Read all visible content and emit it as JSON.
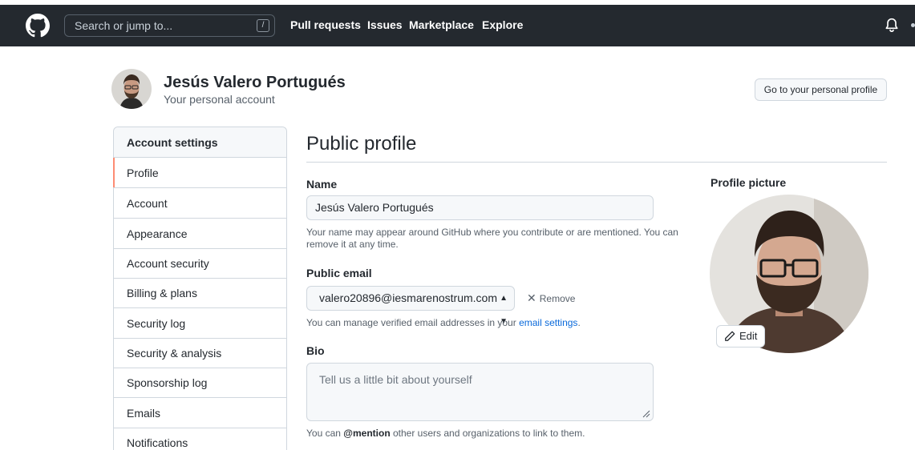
{
  "header": {
    "search_placeholder": "Search or jump to...",
    "search_shortcut": "/",
    "nav": [
      "Pull requests",
      "Issues",
      "Marketplace",
      "Explore"
    ]
  },
  "account": {
    "name": "Jesús Valero Portugués",
    "subtitle": "Your personal account",
    "profile_button": "Go to your personal profile"
  },
  "sidebar": {
    "items": [
      {
        "label": "Account settings"
      },
      {
        "label": "Profile"
      },
      {
        "label": "Account"
      },
      {
        "label": "Appearance"
      },
      {
        "label": "Account security"
      },
      {
        "label": "Billing & plans"
      },
      {
        "label": "Security log"
      },
      {
        "label": "Security & analysis"
      },
      {
        "label": "Sponsorship log"
      },
      {
        "label": "Emails"
      },
      {
        "label": "Notifications"
      }
    ]
  },
  "main": {
    "title": "Public profile",
    "name_label": "Name",
    "name_value": "Jesús Valero Portugués",
    "name_note_line1": "Your name may appear around GitHub where you contribute or are mentioned. You can",
    "name_note_line2": "remove it at any time.",
    "email_label": "Public email",
    "email_value": "valero20896@iesmarenostrum.com",
    "remove_label": "Remove",
    "email_note": "You can manage verified email addresses in your",
    "email_link": "email settings",
    "email_note_end": ".",
    "bio_label": "Bio",
    "bio_placeholder": "Tell us a little bit about yourself",
    "bio_note_pre": "You can",
    "bio_note_mention": "@mention",
    "bio_note_post": "other users and organizations to link to them."
  },
  "picture": {
    "label": "Profile picture",
    "edit_label": "Edit"
  },
  "colors": {
    "header_bg": "#24292f",
    "link": "#0969da",
    "active_marker": "#fd8c73",
    "border": "#d0d7de"
  }
}
